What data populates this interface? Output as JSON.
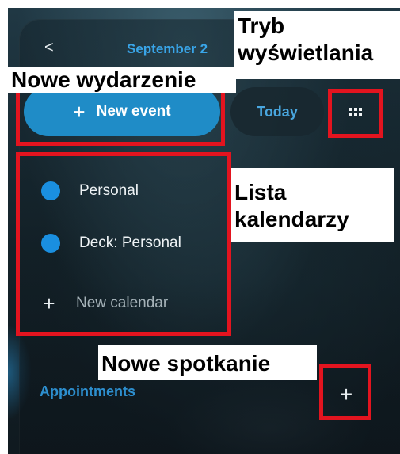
{
  "header": {
    "back_symbol": "<",
    "month_title": "September 2"
  },
  "toolbar": {
    "new_event_plus": "+",
    "new_event_label": "New event",
    "today_label": "Today",
    "view_icon": "grid-icon"
  },
  "calendars": {
    "items": [
      {
        "label": "Personal",
        "color": "#1a8fe0"
      },
      {
        "label": "Deck: Personal",
        "color": "#1a8fe0"
      }
    ],
    "new_plus": "+",
    "new_label": "New calendar"
  },
  "appointments": {
    "title": "Appointments",
    "add_symbol": "+"
  },
  "annotations": {
    "new_event": "Nowe wydarzenie",
    "view_mode_line1": "Tryb",
    "view_mode_line2": "wyświetlania",
    "calendar_list_line1": "Lista",
    "calendar_list_line2": "kalendarzy",
    "new_appointment": "Nowe spotkanie",
    "highlight_color": "#e3141f"
  }
}
